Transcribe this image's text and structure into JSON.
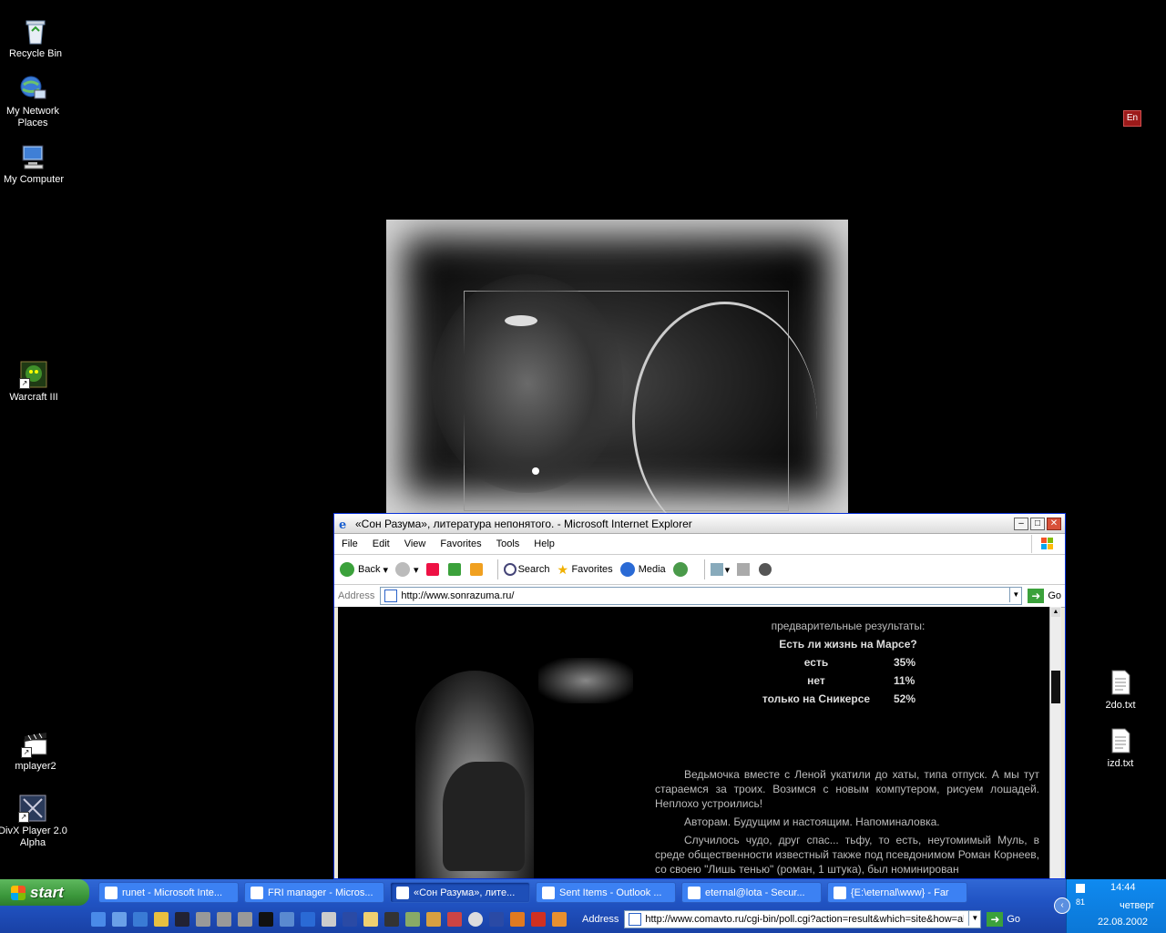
{
  "desktop": {
    "icons": [
      {
        "name": "recycle-bin",
        "label": "Recycle Bin"
      },
      {
        "name": "my-network-places",
        "label": "My Network Places"
      },
      {
        "name": "my-computer",
        "label": "My Computer"
      },
      {
        "name": "warcraft-iii",
        "label": "Warcraft III"
      },
      {
        "name": "mplayer2",
        "label": "mplayer2"
      },
      {
        "name": "divx-player",
        "label": "DivX Player 2.0 Alpha"
      },
      {
        "name": "2do-txt",
        "label": "2do.txt"
      },
      {
        "name": "izd-txt",
        "label": "izd.txt"
      }
    ],
    "language_badge": "En"
  },
  "ie_window": {
    "title": "«Сон Разума», литература непонятого. - Microsoft Internet Explorer",
    "menu": [
      "File",
      "Edit",
      "View",
      "Favorites",
      "Tools",
      "Help"
    ],
    "toolbar": {
      "back": "Back",
      "search": "Search",
      "favorites": "Favorites",
      "media": "Media"
    },
    "address_label": "Address",
    "address_url": "http://www.sonrazuma.ru/",
    "go_label": "Go",
    "page": {
      "poll_pre": "предварительные результаты:",
      "poll_question": "Есть ли жизнь на Марсе?",
      "poll_options": [
        {
          "option": "есть",
          "percent": "35%"
        },
        {
          "option": "нет",
          "percent": "11%"
        },
        {
          "option": "только на Сникерсе",
          "percent": "52%"
        }
      ],
      "para1": "Ведьмочка вместе с Леной укатили до хаты, типа отпуск. А мы тут стараемся за троих. Возимся с новым компутером, рисуем лошадей. Неплохо устроились!",
      "para2": "Авторам. Будущим и настоящим. Напоминаловка.",
      "para3": "Случилось чудо, друг спас... тьфу, то есть, неутомимый Муль, в среде общественности известный также под псевдонимом Роман Корнеев, со своею \"Лишь тенью\" (роман, 1 штука), был номинирован"
    }
  },
  "taskbar": {
    "start_label": "start",
    "buttons": [
      {
        "label": "runet - Microsoft Inte...",
        "active": false
      },
      {
        "label": "FRI manager - Micros...",
        "active": false
      },
      {
        "label": "«Сон Разума», лите...",
        "active": true
      },
      {
        "label": "Sent Items - Outlook ...",
        "active": false
      },
      {
        "label": "eternal@lota - Secur...",
        "active": false
      },
      {
        "label": "{E:\\eternal\\www} - Far",
        "active": false
      }
    ],
    "address_label": "Address",
    "address_url": "http://www.comavto.ru/cgi-bin/poll.cgi?action=result&which=site&how=all",
    "go_label": "Go"
  },
  "tray": {
    "indicator": "81",
    "time": "14:44",
    "day": "четверг",
    "date": "22.08.2002"
  }
}
